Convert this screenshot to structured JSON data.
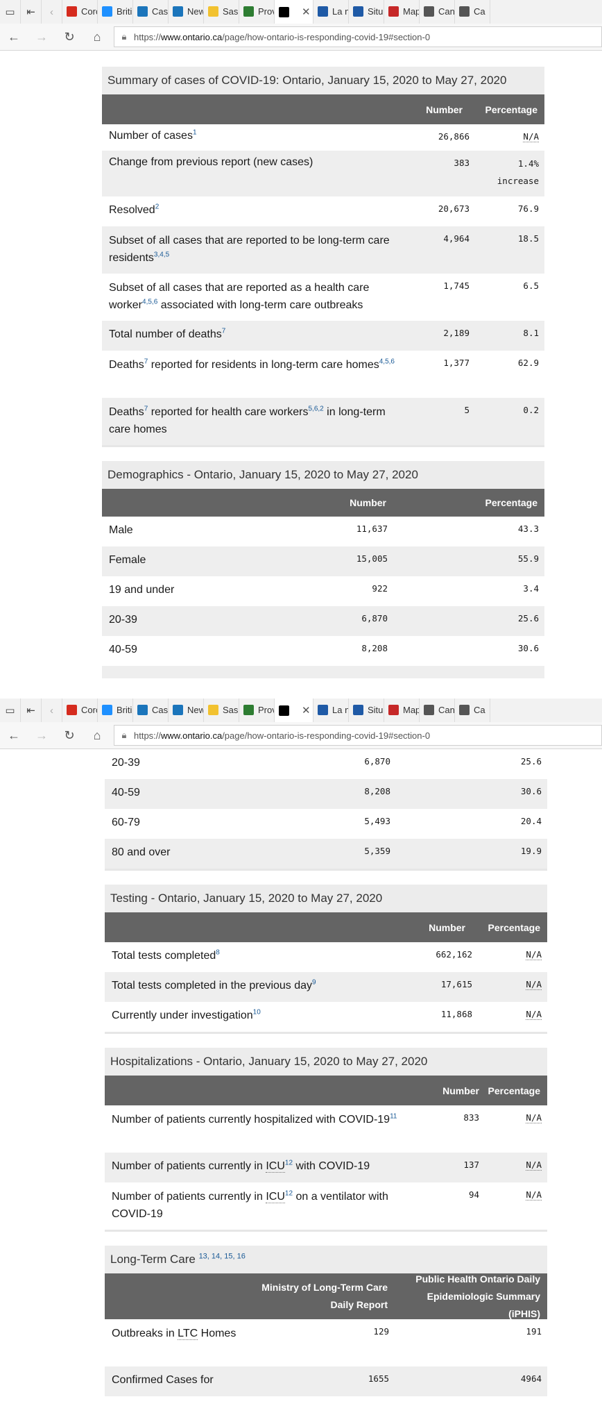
{
  "browser": {
    "tabs": [
      {
        "label": "Coro",
        "icon": "maple-leaf-icon",
        "color": "#d52b1e"
      },
      {
        "label": "Briti",
        "icon": "bc-icon",
        "color": "#1e90ff"
      },
      {
        "label": "Case",
        "icon": "alberta-icon",
        "color": "#1b75bb"
      },
      {
        "label": "New",
        "icon": "alberta-icon",
        "color": "#1b75bb"
      },
      {
        "label": "Sask",
        "icon": "sask-icon",
        "color": "#f2c230"
      },
      {
        "label": "Prov",
        "icon": "manitoba-icon",
        "color": "#2e7d32"
      },
      {
        "label": "",
        "icon": "ontario-icon",
        "color": "#000000",
        "active": true
      },
      {
        "label": "La n",
        "icon": "quebec-icon",
        "color": "#1f5aa6"
      },
      {
        "label": "Situ",
        "icon": "quebec-icon",
        "color": "#1f5aa6"
      },
      {
        "label": "Map",
        "icon": "map-icon",
        "color": "#c62828"
      },
      {
        "label": "Can",
        "icon": "page-icon",
        "color": "#555555"
      },
      {
        "label": "Ca",
        "icon": "page-icon",
        "color": "#555555"
      }
    ],
    "url_prefix": "https://",
    "url_host": "www.ontario.ca",
    "url_path": "/page/how-ontario-is-responding-covid-19#section-0"
  },
  "summary": {
    "title": "Summary of cases of COVID-19: Ontario, January 15, 2020 to May 27, 2020",
    "col_number": "Number",
    "col_percentage": "Percentage",
    "rows": [
      {
        "label": "Number of cases",
        "sup": "1",
        "number": "26,866",
        "pct": "N/A"
      },
      {
        "label": "Change from previous report (new cases)",
        "number": "383",
        "pct": "1.4%",
        "pct2": "increase"
      },
      {
        "label": "Resolved",
        "sup": "2",
        "number": "20,673",
        "pct": "76.9"
      },
      {
        "label": "Subset of all cases that are reported to be long-term care residents",
        "sup": "3,4,5",
        "number": "4,964",
        "pct": "18.5"
      },
      {
        "label_a": "Subset of all cases that are reported as a health care worker",
        "sup": "4,5,6",
        "label_b": " associated with long-term care outbreaks",
        "number": "1,745",
        "pct": "6.5"
      },
      {
        "label": "Total number of deaths",
        "sup": "7",
        "number": "2,189",
        "pct": "8.1"
      },
      {
        "label_a": "Deaths",
        "sup_a": "7",
        "label_b": " reported for residents in long-term care homes",
        "sup": "4,5,6",
        "number": "1,377",
        "pct": "62.9"
      },
      {
        "label_a": "Deaths",
        "sup_a": "7",
        "label_b": " reported for health care workers",
        "sup_b": "5,6,2",
        "label_c": " in long-term care homes",
        "number": "5",
        "pct": "0.2"
      }
    ]
  },
  "demographics": {
    "title": "Demographics - Ontario, January 15, 2020 to May 27, 2020",
    "col_number": "Number",
    "col_percentage": "Percentage",
    "rows": [
      {
        "label": "Male",
        "number": "11,637",
        "pct": "43.3"
      },
      {
        "label": "Female",
        "number": "15,005",
        "pct": "55.9"
      },
      {
        "label": "19 and under",
        "number": "922",
        "pct": "3.4"
      },
      {
        "label": "20-39",
        "number": "6,870",
        "pct": "25.6"
      },
      {
        "label": "40-59",
        "number": "8,208",
        "pct": "30.6"
      },
      {
        "label": "60-79",
        "number": "5,493",
        "pct": "20.4"
      },
      {
        "label": "80 and over",
        "number": "5,359",
        "pct": "19.9"
      }
    ]
  },
  "testing": {
    "title": "Testing - Ontario, January 15, 2020 to May 27, 2020",
    "col_number": "Number",
    "col_percentage": "Percentage",
    "rows": [
      {
        "label": "Total tests completed",
        "sup": "8",
        "number": "662,162",
        "pct": "N/A"
      },
      {
        "label": "Total tests completed in the previous day",
        "sup": "9",
        "number": "17,615",
        "pct": "N/A"
      },
      {
        "label": "Currently under investigation",
        "sup": "10",
        "number": "11,868",
        "pct": "N/A"
      }
    ]
  },
  "hospitalizations": {
    "title": "Hospitalizations - Ontario, January 15, 2020 to May 27, 2020",
    "col_number": "Number",
    "col_percentage": "Percentage",
    "rows": [
      {
        "label": "Number of patients currently hospitalized with COVID-19",
        "sup": "11",
        "number": "833",
        "pct": "N/A"
      },
      {
        "label_a": "Number of patients currently in ",
        "abbr": "ICU",
        "sup": "12",
        "label_b": " with COVID-19",
        "number": "137",
        "pct": "N/A"
      },
      {
        "label_a": "Number of patients currently in ",
        "abbr": "ICU",
        "sup": "12",
        "label_b": " on a ventilator with COVID-19",
        "number": "94",
        "pct": "N/A"
      }
    ]
  },
  "ltc": {
    "title": "Long-Term Care",
    "title_sup": "13, 14, 15, 16",
    "col_a": "Ministry of Long-Term Care Daily Report",
    "col_b": "Public Health Ontario Daily Epidemiologic Summary (iPHIS)",
    "rows": [
      {
        "label_a": "Outbreaks in ",
        "abbr": "LTC",
        "label_b": " Homes",
        "a": "129",
        "b": "191"
      },
      {
        "label": "Confirmed Cases for",
        "a": "1655",
        "b": "4964"
      }
    ]
  }
}
